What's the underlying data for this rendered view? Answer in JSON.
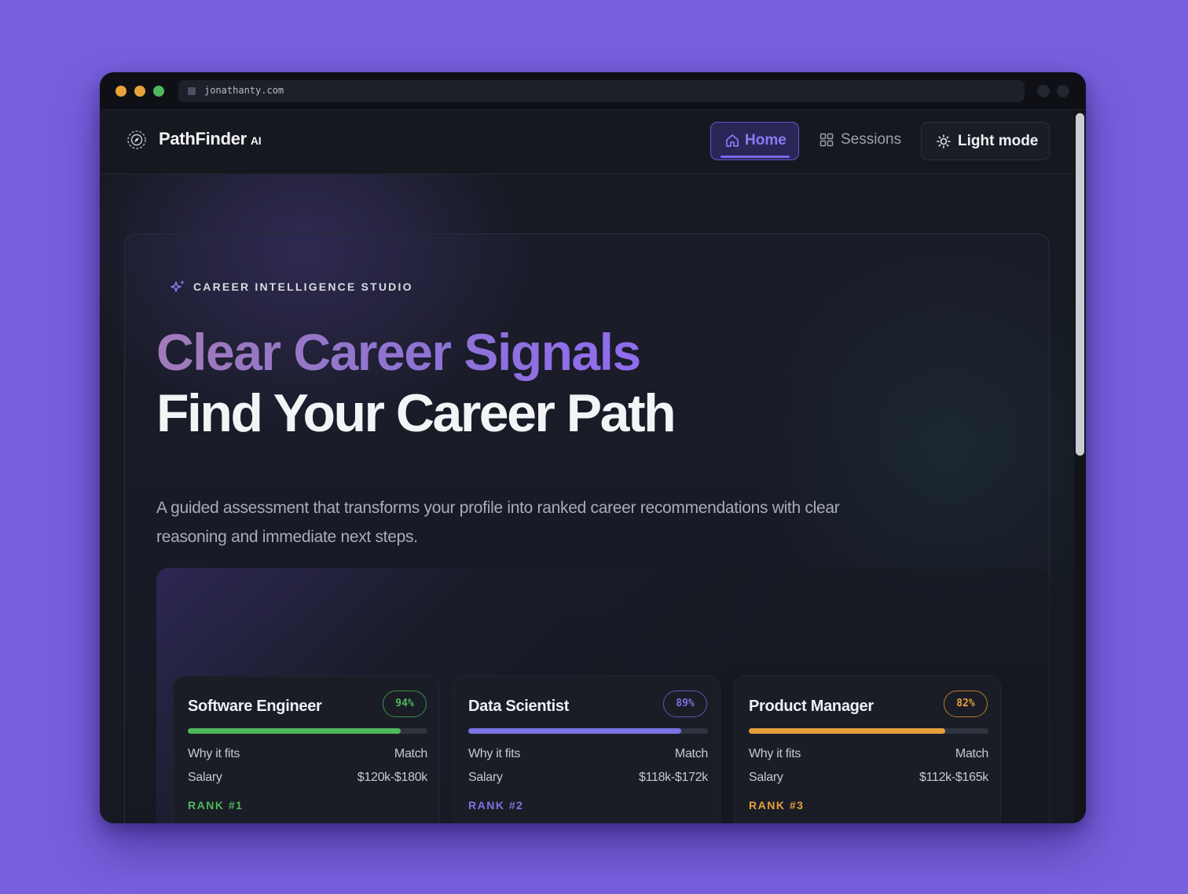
{
  "browser": {
    "url": "jonathanty.com"
  },
  "nav": {
    "brand": "PathFinder",
    "brand_suffix": "AI",
    "home_label": "Home",
    "sessions_label": "Sessions",
    "theme_label": "Light mode"
  },
  "hero": {
    "eyebrow": "CAREER INTELLIGENCE STUDIO",
    "headline_line1": "Clear Career Signals",
    "headline_line2": "Find Your Career Path",
    "subtitle": "A guided assessment that transforms your profile into ranked career recommendations with clear reasoning and immediate next steps."
  },
  "careers": [
    {
      "title": "Software Engineer",
      "match": "94%",
      "match_fraction": 0.89,
      "color": "#4fb85c",
      "why_label": "Why it fits",
      "why_value": "Match",
      "salary_label": "Salary",
      "salary_value": "$120k-$180k",
      "rank": "RANK #1"
    },
    {
      "title": "Data Scientist",
      "match": "89%",
      "match_fraction": 0.89,
      "color": "#7b74e4",
      "why_label": "Why it fits",
      "why_value": "Match",
      "salary_label": "Salary",
      "salary_value": "$118k-$172k",
      "rank": "RANK #2"
    },
    {
      "title": "Product Manager",
      "match": "82%",
      "match_fraction": 0.82,
      "color": "#e6a03b",
      "why_label": "Why it fits",
      "why_value": "Match",
      "salary_label": "Salary",
      "salary_value": "$112k-$165k",
      "rank": "RANK #3"
    }
  ],
  "colors": {
    "background": "#7860dd",
    "accent": "#7b68ee",
    "surface": "#161921"
  }
}
